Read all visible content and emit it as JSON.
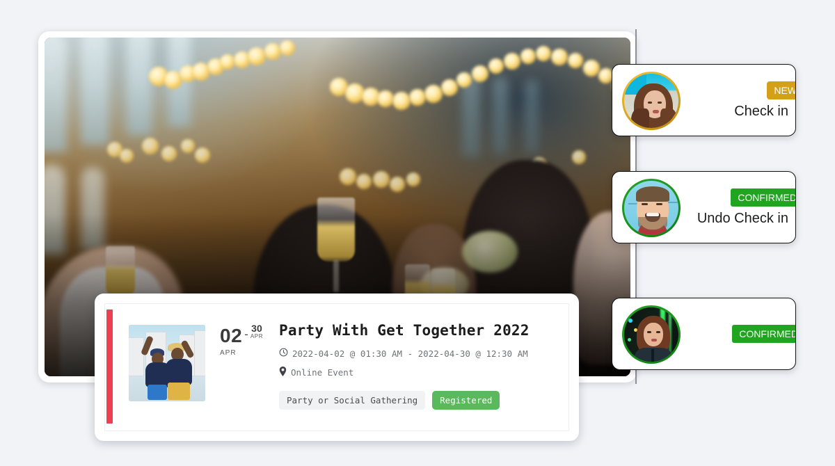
{
  "theme": {
    "page_background": "#f2f3f7",
    "accent_red": "#ee3e54",
    "badge_new_color": "#d4a017",
    "badge_confirmed_color": "#21a521",
    "registered_badge_color": "#5cb85c",
    "divider_color": "#8b8f99"
  },
  "hero": {
    "name": "event-hero-photo",
    "alt": "Blurred party scene with string bokeh lights and people toasting champagne glasses"
  },
  "event": {
    "date": {
      "start_day": "02",
      "start_month": "APR",
      "separator": "-",
      "end_day": "30",
      "end_month": "APR"
    },
    "title": "Party With Get Together 2022",
    "time_icon": "clock-icon",
    "time_range": "2022-04-02 @ 01:30 AM - 2022-04-30 @ 12:30 AM",
    "location_icon": "map-pin-icon",
    "location": "Online Event",
    "category_tag": "Party or Social Gathering",
    "status_badge": "Registered",
    "thumbnail_alt": "Two friends celebrating outdoors"
  },
  "attendees": [
    {
      "id": "attendee-1",
      "avatar_alt": "Woman with long brown hair against blue wall",
      "ring_color": "#d4a017",
      "badge": "NEW",
      "badge_type": "new",
      "action": "Check in"
    },
    {
      "id": "attendee-2",
      "avatar_alt": "Laughing bearded man against light blue wall",
      "ring_color": "#21a521",
      "badge": "CONFIRMED",
      "badge_type": "confirmed",
      "action": "Undo Check in"
    },
    {
      "id": "attendee-3",
      "avatar_alt": "Woman in dark jacket with green neon lights behind",
      "ring_color": "#21a521",
      "badge": "CONFIRMED",
      "badge_type": "confirmed",
      "action": "",
      "stacked": true,
      "stack_count": 5
    }
  ]
}
